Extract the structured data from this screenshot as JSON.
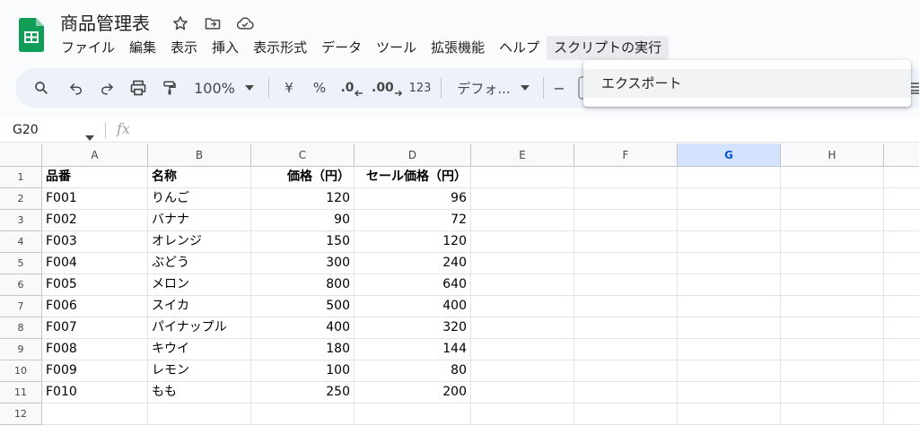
{
  "app": {
    "doc_title": "商品管理表",
    "menu": [
      "ファイル",
      "編集",
      "表示",
      "挿入",
      "表示形式",
      "データ",
      "ツール",
      "拡張機能",
      "ヘルプ",
      "スクリプトの実行"
    ],
    "active_menu_index": 9
  },
  "toolbar": {
    "zoom": "100%",
    "currency": "¥",
    "percent": "%",
    "decrease_decimal": ".0",
    "increase_decimal": ".00",
    "number_format": "123",
    "font": "デフォ...",
    "minus": "−"
  },
  "dropdown": {
    "items": [
      "エクスポート"
    ]
  },
  "formula_bar": {
    "name_box": "G20",
    "fx": "fx"
  },
  "sheet": {
    "columns": [
      "A",
      "B",
      "C",
      "D",
      "E",
      "F",
      "G",
      "H"
    ],
    "selected_column": "G",
    "row_numbers": [
      "1",
      "2",
      "3",
      "4",
      "5",
      "6",
      "7",
      "8",
      "9",
      "10",
      "11",
      "12"
    ],
    "header": [
      "品番",
      "名称",
      "価格（円）",
      "セール価格（円）"
    ],
    "rows": [
      [
        "F001",
        "りんご",
        "120",
        "96"
      ],
      [
        "F002",
        "バナナ",
        "90",
        "72"
      ],
      [
        "F003",
        "オレンジ",
        "150",
        "120"
      ],
      [
        "F004",
        "ぶどう",
        "300",
        "240"
      ],
      [
        "F005",
        "メロン",
        "800",
        "640"
      ],
      [
        "F006",
        "スイカ",
        "500",
        "400"
      ],
      [
        "F007",
        "パイナップル",
        "400",
        "320"
      ],
      [
        "F008",
        "キウイ",
        "180",
        "144"
      ],
      [
        "F009",
        "レモン",
        "100",
        "80"
      ],
      [
        "F010",
        "もも",
        "250",
        "200"
      ]
    ]
  },
  "colors": {
    "logo_green": "#0f9d58",
    "selected_header_bg": "#d3e3fd",
    "selected_header_text": "#0b57d0",
    "toolbar_bg": "#edf2fa"
  }
}
